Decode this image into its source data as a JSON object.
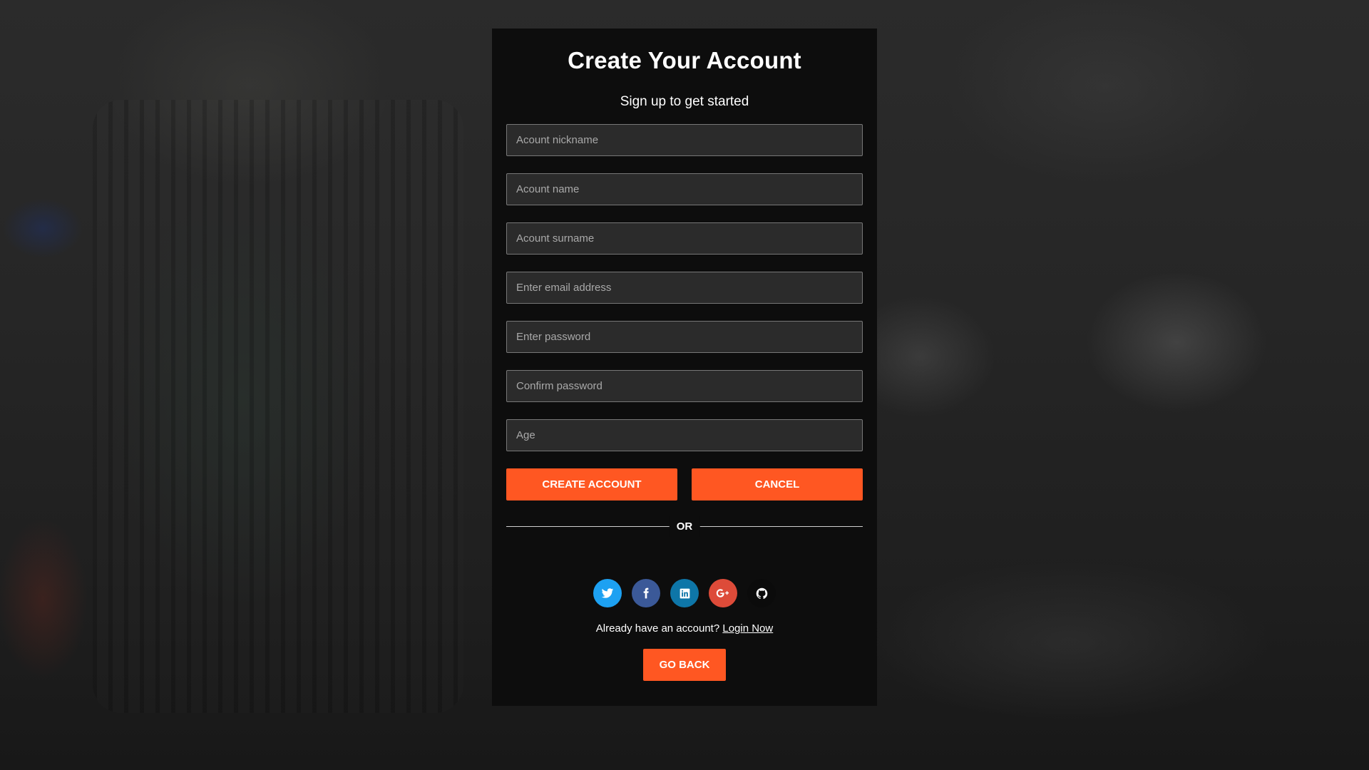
{
  "form": {
    "title": "Create Your Account",
    "subtitle": "Sign up to get started",
    "fields": {
      "nickname": {
        "placeholder": "Acount nickname",
        "value": ""
      },
      "name": {
        "placeholder": "Acount name",
        "value": ""
      },
      "surname": {
        "placeholder": "Acount surname",
        "value": ""
      },
      "email": {
        "placeholder": "Enter email address",
        "value": ""
      },
      "password": {
        "placeholder": "Enter password",
        "value": ""
      },
      "confirm_password": {
        "placeholder": "Confirm password",
        "value": ""
      },
      "age": {
        "placeholder": "Age",
        "value": ""
      }
    },
    "create_label": "CREATE ACCOUNT",
    "cancel_label": "CANCEL",
    "divider_label": "OR"
  },
  "socials": [
    {
      "icon": "twitter-icon",
      "color": "#1da1f2"
    },
    {
      "icon": "facebook-icon",
      "color": "#3b5998"
    },
    {
      "icon": "linkedin-icon",
      "color": "#0e76a8"
    },
    {
      "icon": "google-plus-icon",
      "color": "#dd4b39"
    },
    {
      "icon": "github-icon",
      "color": "#0b0b0b"
    }
  ],
  "footer": {
    "login_prompt": "Already have an account?",
    "login_link": "Login Now",
    "back_label": "GO BACK"
  },
  "colors": {
    "accent": "#ff5722",
    "panel": "#0d0d0d",
    "input_bg": "#2b2b2b"
  }
}
